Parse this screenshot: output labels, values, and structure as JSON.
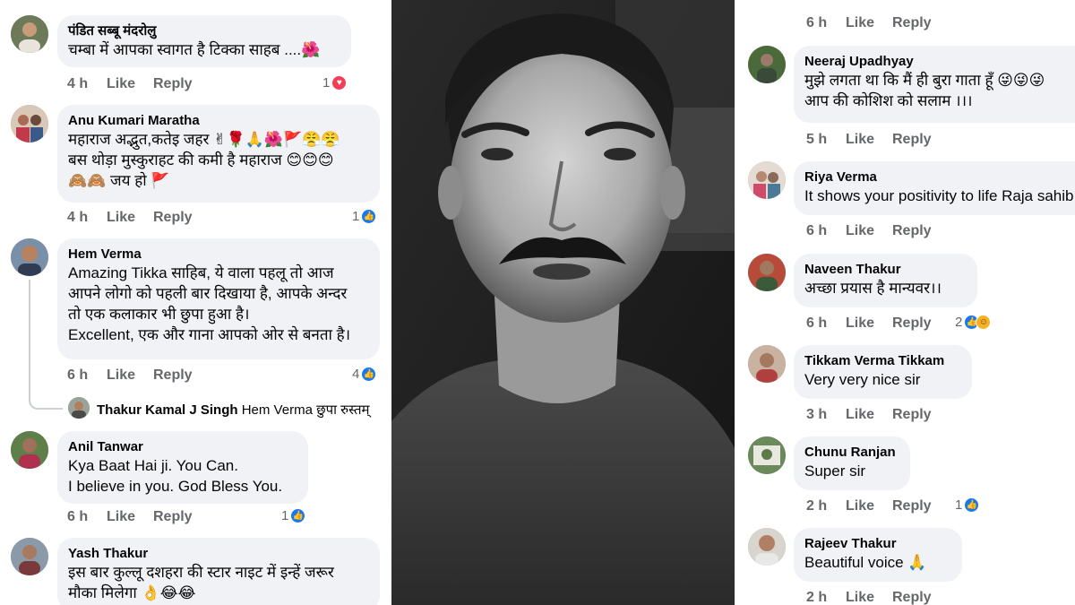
{
  "left_comments": [
    {
      "author": "पंडित सब्बू मंदरोलु",
      "text": [
        "चम्बा में आपका स्वागत है टिक्का साहब ....🌺"
      ],
      "time": "4 h",
      "like": "Like",
      "reply": "Reply",
      "reaction_count": "1",
      "reaction": "love"
    },
    {
      "author": "Anu Kumari Maratha",
      "text": [
        "महाराज अद्भुत,कतेइ जहर ✌🌹🙏🌺🚩😤😤",
        "बस थोड़ा मुस्कुराहट की कमी है महाराज 😊😊😊",
        "🙈🙈 जय हो 🚩"
      ],
      "time": "4 h",
      "like": "Like",
      "reply": "Reply",
      "reaction_count": "1",
      "reaction": "like"
    },
    {
      "author": "Hem Verma",
      "text": [
        "Amazing Tikka साहिब, ये वाला पहलू तो आज",
        "आपने लोगो को पहली बार दिखाया है, आपके अन्दर",
        "तो एक कलाकार भी छुपा हुआ है।",
        "Excellent, एक और गाना आपको ओर से बनता है।"
      ],
      "time": "6 h",
      "like": "Like",
      "reply": "Reply",
      "reaction_count": "4",
      "reaction": "like"
    },
    {
      "author": "Anil Tanwar",
      "text": [
        "Kya Baat Hai ji. You Can.",
        "I believe in you. God Bless You."
      ],
      "time": "6 h",
      "like": "Like",
      "reply": "Reply",
      "reaction_count": "1",
      "reaction": "like"
    },
    {
      "author": "Yash Thakur",
      "text": [
        "इस बार कुल्लू दशहरा की स्टार नाइट में इन्हें जरूर",
        "मौका मिलेगा 👌😂😂"
      ],
      "time": "",
      "like": "",
      "reply": "",
      "reaction_count": "",
      "reaction": ""
    }
  ],
  "nested_reply": {
    "author": "Thakur Kamal J Singh",
    "text": "Hem Verma छुपा रुस्तम्"
  },
  "right_top_meta": {
    "time": "6 h",
    "like": "Like",
    "reply": "Reply"
  },
  "right_comments": [
    {
      "author": "Neeraj Upadhyay",
      "text": [
        "मुझे लगता था कि मैं ही बुरा गाता हूँ 😜😜😜",
        "आप की कोशिश को सलाम ।।।"
      ],
      "time": "5 h",
      "like": "Like",
      "reply": "Reply",
      "reaction_count": "",
      "reaction": ""
    },
    {
      "author": "Riya Verma",
      "text": [
        "It shows your positivity to life Raja sahib"
      ],
      "time": "6 h",
      "like": "Like",
      "reply": "Reply",
      "reaction_count": "",
      "reaction": ""
    },
    {
      "author": "Naveen Thakur",
      "text": [
        "अच्छा प्रयास है मान्यवर।।"
      ],
      "time": "6 h",
      "like": "Like",
      "reply": "Reply",
      "reaction_count": "2",
      "reaction": "like-haha"
    },
    {
      "author": "Tikkam Verma Tikkam",
      "text": [
        "Very very nice sir"
      ],
      "time": "3 h",
      "like": "Like",
      "reply": "Reply",
      "reaction_count": "",
      "reaction": ""
    },
    {
      "author": "Chunu Ranjan",
      "text": [
        "Super sir"
      ],
      "time": "2 h",
      "like": "Like",
      "reply": "Reply",
      "reaction_count": "1",
      "reaction": "like"
    },
    {
      "author": "Rajeev Thakur",
      "text": [
        "Beautiful voice 🙏"
      ],
      "time": "2 h",
      "like": "Like",
      "reply": "Reply",
      "reaction_count": "",
      "reaction": ""
    }
  ],
  "icons": {
    "like": "thumbs-up-icon",
    "love": "heart-icon",
    "haha": "laugh-icon"
  },
  "colors": {
    "bubble": "#f0f2f5",
    "meta_text": "#65676b",
    "like_blue": "#1877f2",
    "love_red": "#f33e58",
    "haha_yellow": "#f7b125"
  }
}
